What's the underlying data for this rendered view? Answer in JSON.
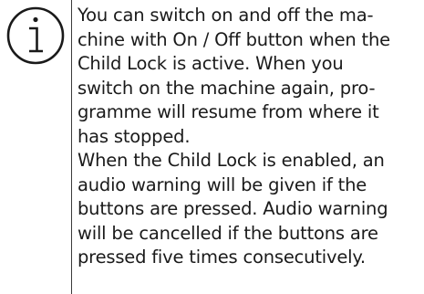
{
  "info_note": {
    "icon": "info-icon",
    "lines": [
      "You can switch on and off the ma-",
      "chine with On / Off button when the",
      "Child Lock is active. When you",
      "switch on the machine again, pro-",
      "gramme will resume from where it",
      "has stopped.",
      "When the Child Lock is enabled, an",
      "audio warning will be given if the",
      "buttons are pressed. Audio warning",
      "will be cancelled if the buttons are",
      "pressed five times consecutively."
    ]
  }
}
